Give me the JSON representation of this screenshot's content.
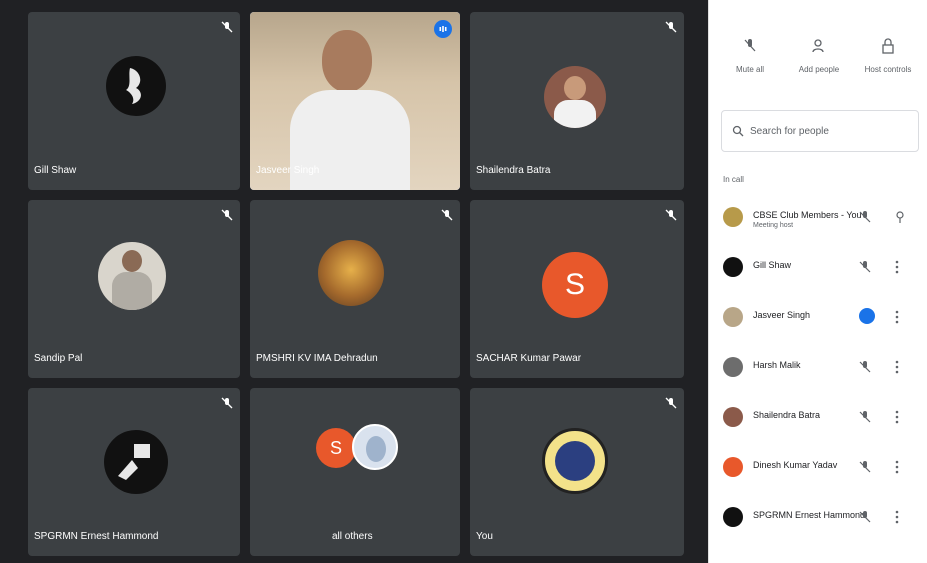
{
  "tiles": [
    {
      "name": "Gill Shaw",
      "mic_muted": true
    },
    {
      "name": "Jasveer Singh",
      "speaking": true
    },
    {
      "name": "Shailendra Batra",
      "mic_muted": true
    },
    {
      "name": "Sandip Pal",
      "mic_muted": true
    },
    {
      "name": "PMSHRI KV IMA Dehradun",
      "mic_muted": true
    },
    {
      "name": "SACHAR Kumar Pawar",
      "mic_muted": true,
      "initial": "S"
    },
    {
      "name": "SPGRMN Ernest Hammond",
      "mic_muted": true
    },
    {
      "name": "all others",
      "initial": "S"
    },
    {
      "name": "You",
      "mic_muted": true
    }
  ],
  "sidebar": {
    "actions": [
      {
        "label": "Mute all",
        "icon": "mic-off-icon"
      },
      {
        "label": "Add people",
        "icon": "add-person-icon"
      },
      {
        "label": "Host controls",
        "icon": "lock-icon"
      }
    ],
    "search_placeholder": "Search for people",
    "section_label": "In call",
    "people": [
      {
        "name": "CBSE Club Members - You",
        "sub": "Meeting host",
        "state": "mute"
      },
      {
        "name": "Gill Shaw",
        "state": "mute"
      },
      {
        "name": "Jasveer Singh",
        "state": "speaking"
      },
      {
        "name": "Harsh Malik",
        "state": "mute"
      },
      {
        "name": "Shailendra Batra",
        "state": "mute"
      },
      {
        "name": "Dinesh Kumar Yadav",
        "state": "mute"
      },
      {
        "name": "SPGRMN Ernest Hammond",
        "state": "mute"
      }
    ]
  },
  "colors": {
    "background": "#202124",
    "tile": "#3c4043",
    "accent_blue": "#1a73e8",
    "avatar_orange": "#e8582b"
  }
}
